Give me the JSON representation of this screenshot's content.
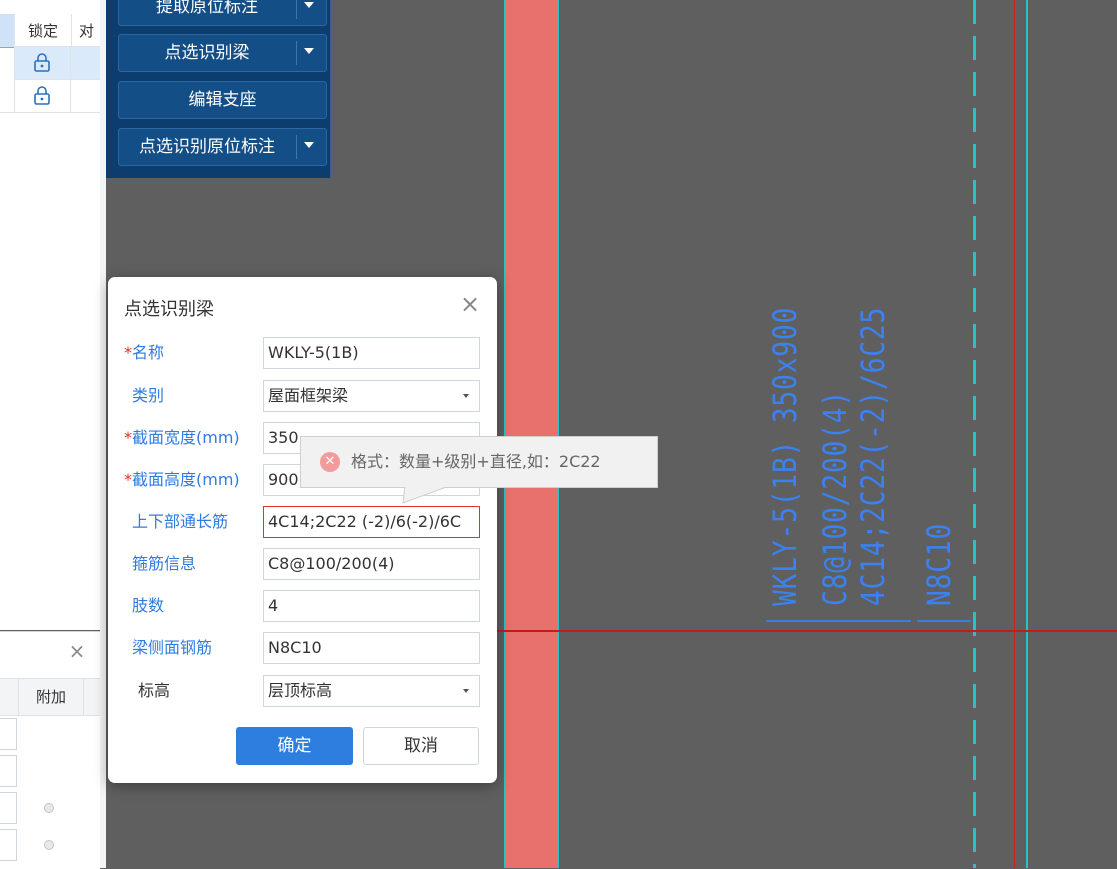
{
  "property_grid": {
    "header_locked": "锁定",
    "header_cut": "对",
    "rows": [
      {
        "locked": true,
        "selected": true
      },
      {
        "locked": true,
        "selected": false
      }
    ]
  },
  "second_panel": {
    "close_label": "×",
    "header_label": "附加"
  },
  "toolbar": {
    "buttons": [
      {
        "label": "提取原位标注",
        "has_dropdown": true
      },
      {
        "label": "点选识别梁",
        "has_dropdown": true
      },
      {
        "label": "编辑支座",
        "has_dropdown": false
      },
      {
        "label": "点选识别原位标注",
        "has_dropdown": true
      }
    ]
  },
  "drawing": {
    "annotation_lines": [
      "WKLY-5(1B) 350x900",
      "C8@100/200(4)",
      "4C14;2C22(-2)/6C25",
      "N8C10"
    ],
    "colors": {
      "background": "#5f5f5f",
      "beam_band": "#e8706d",
      "axis_cyan": "#29c3c7",
      "axis_red": "#d0201e",
      "annotation_text": "#3b82f0"
    }
  },
  "dialog": {
    "title": "点选识别梁",
    "close_label": "×",
    "fields": [
      {
        "label": "名称",
        "required": true,
        "value": "WKLY-5(1B)"
      },
      {
        "label": "类别",
        "required": false,
        "value": "屋面框架梁",
        "dropdown": true
      },
      {
        "label": "截面宽度(mm)",
        "required": true,
        "value": "350"
      },
      {
        "label": "截面高度(mm)",
        "required": true,
        "value": "900"
      },
      {
        "label": "上下部通长筋",
        "required": false,
        "value": "4C14;2C22 (-2)/6(-2)/6C",
        "error": true
      },
      {
        "label": "箍筋信息",
        "required": false,
        "value": "C8@100/200(4)"
      },
      {
        "label": "肢数",
        "required": false,
        "value": "4"
      },
      {
        "label": "梁侧面钢筋",
        "required": false,
        "value": "N8C10"
      },
      {
        "label": "标高",
        "required": false,
        "value": "层顶标高",
        "dropdown": true
      }
    ],
    "ok_label": "确定",
    "cancel_label": "取消",
    "required_mark": "*",
    "accent": "#2e7ee0",
    "error_color": "#e0322b"
  },
  "tooltip": {
    "icon": "error-circle-icon",
    "icon_glyph": "✕",
    "text": "格式：数量+级别+直径,如：2C22"
  }
}
